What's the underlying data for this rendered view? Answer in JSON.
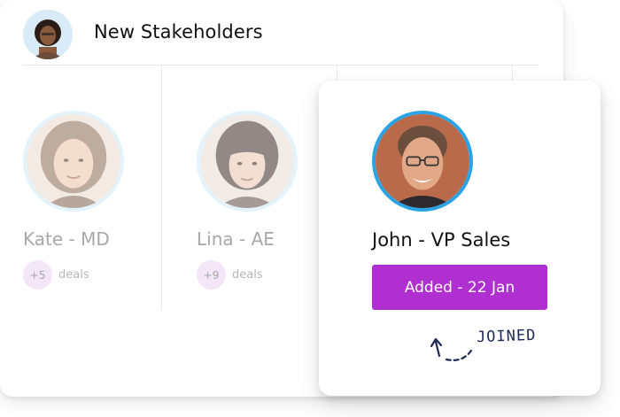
{
  "header": {
    "title": "New Stakeholders"
  },
  "stakeholders": [
    {
      "name": "Kate - MD",
      "deals_count": "+5",
      "deals_label": "deals"
    },
    {
      "name": "Lina - AE",
      "deals_count": "+9",
      "deals_label": "deals"
    }
  ],
  "featured": {
    "name": "John - VP Sales",
    "status_button": "Added - 22 Jan",
    "annotation": "JOINED"
  },
  "colors": {
    "accent": "#b02fd1",
    "avatar_ring": "#2aa3e6",
    "badge_bg": "#f3e6f6"
  },
  "icons": {
    "joined_arrow": "curved-dashed-arrow-icon"
  }
}
